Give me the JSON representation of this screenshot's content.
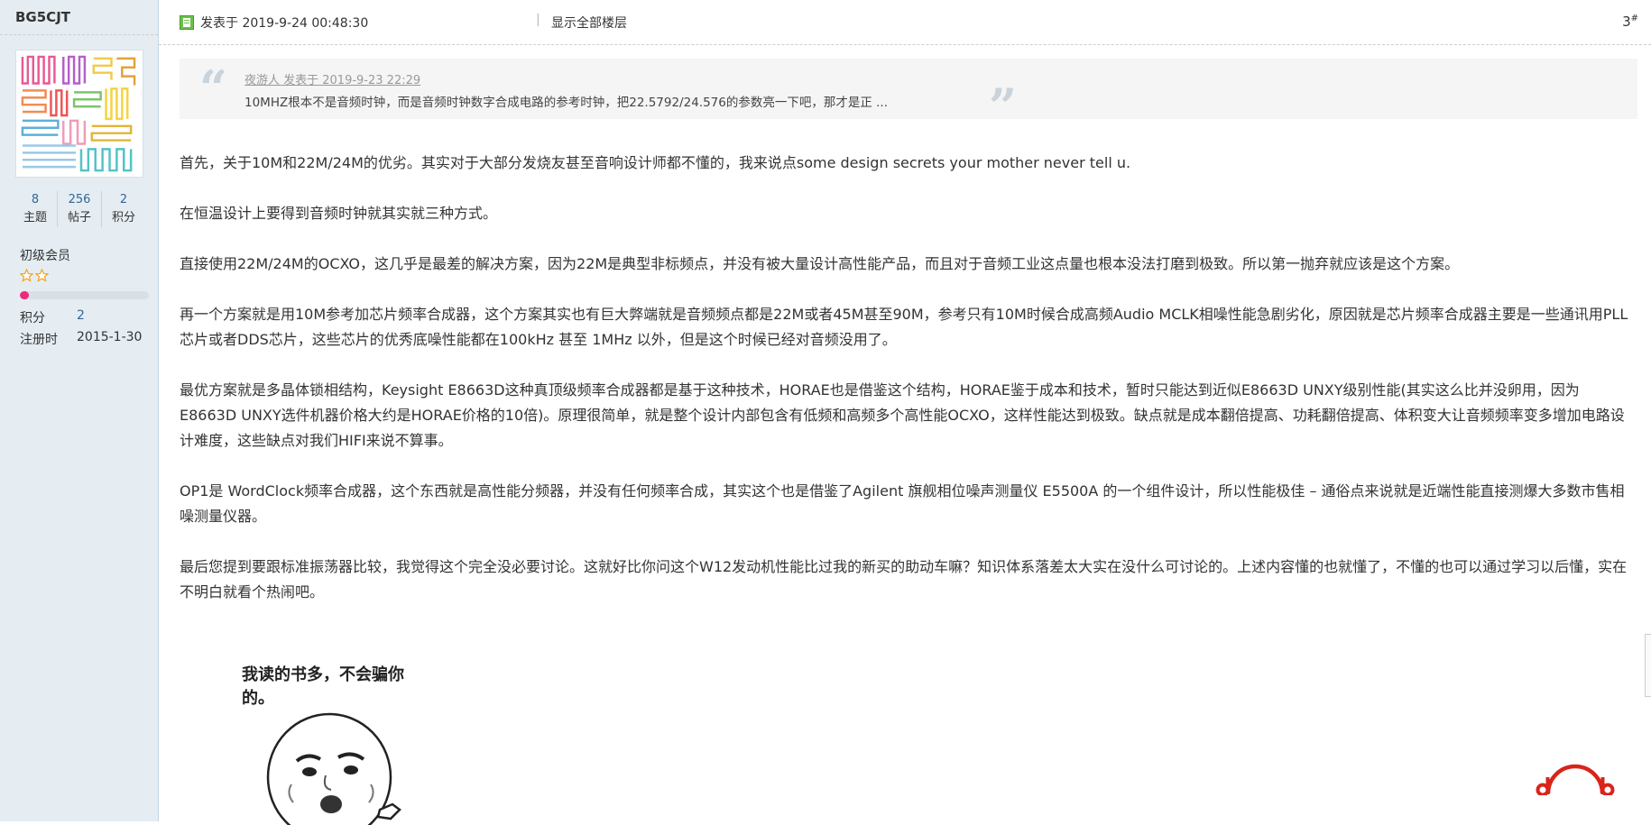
{
  "author": {
    "username": "BG5CJT",
    "stats": [
      {
        "value": "8",
        "label": "主题"
      },
      {
        "value": "256",
        "label": "帖子"
      },
      {
        "value": "2",
        "label": "积分"
      }
    ],
    "group": "初级会员",
    "star_count": 2,
    "level_progress": 0.07,
    "points_label": "积分",
    "points_value": "2",
    "register_label": "注册时",
    "register_date": "2015-1-30"
  },
  "post": {
    "time_text": "发表于 2019-9-24 00:48:30",
    "separator": "|",
    "show_all": "显示全部楼层",
    "floor_number": "3",
    "floor_suffix": "#",
    "quote_author": "夜游人 发表于 2019-9-23 22:29",
    "quote_text": "10MHZ根本不是音频时钟，而是音频时钟数字合成电路的参考时钟，把22.5792/24.576的参数亮一下吧，那才是正 ...",
    "paragraphs": [
      "首先，关于10M和22M/24M的优劣。其实对于大部分发烧友甚至音响设计师都不懂的，我来说点some design secrets your mother never tell u.",
      "在恒温设计上要得到音频时钟就其实就三种方式。",
      "直接使用22M/24M的OCXO，这几乎是最差的解决方案，因为22M是典型非标频点，并没有被大量设计高性能产品，而且对于音频工业这点量也根本没法打磨到极致。所以第一抛弃就应该是这个方案。",
      "再一个方案就是用10M参考加芯片频率合成器，这个方案其实也有巨大弊端就是音频频点都是22M或者45M甚至90M，参考只有10M时候合成高频Audio MCLK相噪性能急剧劣化，原因就是芯片频率合成器主要是一些通讯用PLL芯片或者DDS芯片，这些芯片的优秀底噪性能都在100kHz 甚至 1MHz 以外，但是这个时候已经对音频没用了。",
      "最优方案就是多晶体锁相结构，Keysight E8663D这种真顶级频率合成器都是基于这种技术，HORAE也是借鉴这个结构，HORAE鉴于成本和技术，暂时只能达到近似E8663D UNXY级别性能(其实这么比并没卵用，因为E8663D UNXY选件机器价格大约是HORAE价格的10倍)。原理很简单，就是整个设计内部包含有低频和高频多个高性能OCXO，这样性能达到极致。缺点就是成本翻倍提高、功耗翻倍提高、体积变大让音频频率变多增加电路设计难度，这些缺点对我们HIFI来说不算事。",
      "OP1是 WordClock频率合成器，这个东西就是高性能分频器，并没有任何频率合成，其实这个也是借鉴了Agilent 旗舰相位噪声测量仪 E5500A 的一个组件设计，所以性能极佳 – 通俗点来说就是近端性能直接测爆大多数市售相噪测量仪器。",
      "最后您提到要跟标准振荡器比较，我觉得这个完全没必要讨论。这就好比你问这个W12发动机性能比过我的新买的助动车嘛？知识体系落差太大实在没什么可讨论的。上述内容懂的也就懂了，不懂的也可以通过学习以后懂，实在不明白就看个热闹吧。"
    ],
    "meme_caption": "我读的书多，不会骗你的。"
  },
  "colors": {
    "sidebar_bg": "#e5edf2",
    "link": "#336699",
    "progress": "#ee2a7b",
    "star": "#f3a318"
  },
  "icons": [
    "online-status-icon",
    "star-icon",
    "quote-open-icon",
    "quote-close-icon",
    "site-logo-icon"
  ]
}
